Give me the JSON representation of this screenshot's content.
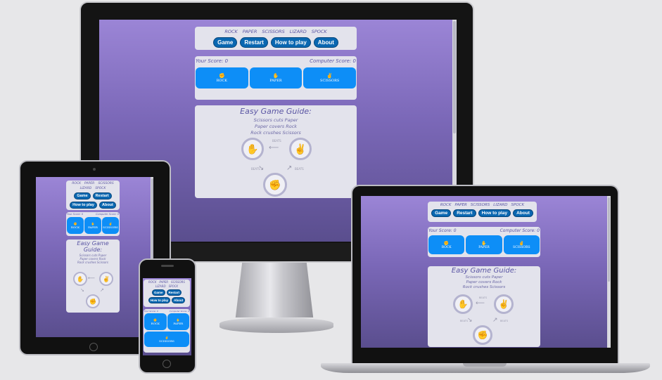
{
  "nav": {
    "links": [
      "ROCK",
      "PAPER",
      "SCISSORS",
      "LIZARD",
      "SPOCK"
    ],
    "buttons": [
      "Game",
      "Restart",
      "How to play",
      "About"
    ]
  },
  "scores": {
    "player": "Your Score: 0",
    "computer": "Computer Score: 0"
  },
  "choices": [
    {
      "label": "ROCK",
      "icon": "hand-rock-icon"
    },
    {
      "label": "PAPER",
      "icon": "hand-paper-icon"
    },
    {
      "label": "SCISSORS",
      "icon": "hand-scissors-icon"
    }
  ],
  "guide": {
    "title": "Easy Game Guide:",
    "lines": [
      "Scissors cuts Paper",
      "Paper covers Rock",
      "Rock crushes Scissors"
    ],
    "arrow_label": "BEATS"
  },
  "colors": {
    "background": "#e7e7e9",
    "gradient_top": "#9b85d6",
    "gradient_bottom": "#5a4e8e",
    "button_dark": "#0a67b1",
    "choice_blue": "#0d8ef7",
    "text_purple": "#5a55a3"
  }
}
